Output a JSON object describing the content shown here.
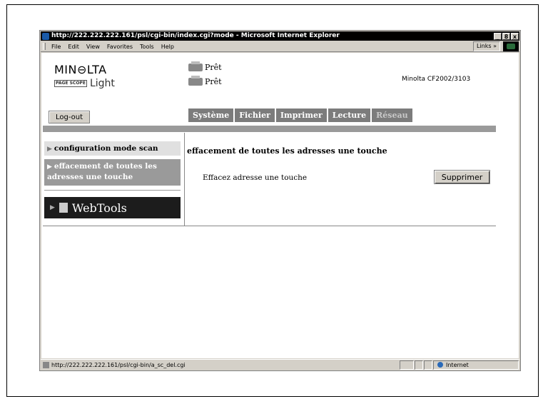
{
  "window": {
    "title": "http://222.222.222.161/psl/cgi-bin/index.cgi?mode - Microsoft Internet Explorer",
    "min": "_",
    "max": "8",
    "close": "x"
  },
  "menu": {
    "items": [
      "File",
      "Edit",
      "View",
      "Favorites",
      "Tools",
      "Help"
    ],
    "links": "Links »"
  },
  "header": {
    "brand": "MIN⊖LTA",
    "pagescope_small": "PAGE SCOPE",
    "pagescope": "Light",
    "status1": "Prêt",
    "status2": "Prêt",
    "model": "Minolta CF2002/3103"
  },
  "logout": "Log-out",
  "tabs": [
    {
      "label": "Système",
      "active": true
    },
    {
      "label": "Fichier",
      "active": true
    },
    {
      "label": "Imprimer",
      "active": true
    },
    {
      "label": "Lecture",
      "active": true
    },
    {
      "label": "Réseau",
      "active": false
    }
  ],
  "sidebar": {
    "item1": "configuration mode scan",
    "item2_line1": "effacement de toutes les",
    "item2_line2": "adresses une touche",
    "webtools": "WebTools"
  },
  "main": {
    "heading": "effacement de toutes les adresses une touche",
    "label": "Effacez adresse une touche",
    "button": "Supprimer"
  },
  "statusbar": {
    "url": "http://222.222.222.161/psl/cgi-bin/a_sc_del.cgi",
    "zone": "Internet"
  }
}
